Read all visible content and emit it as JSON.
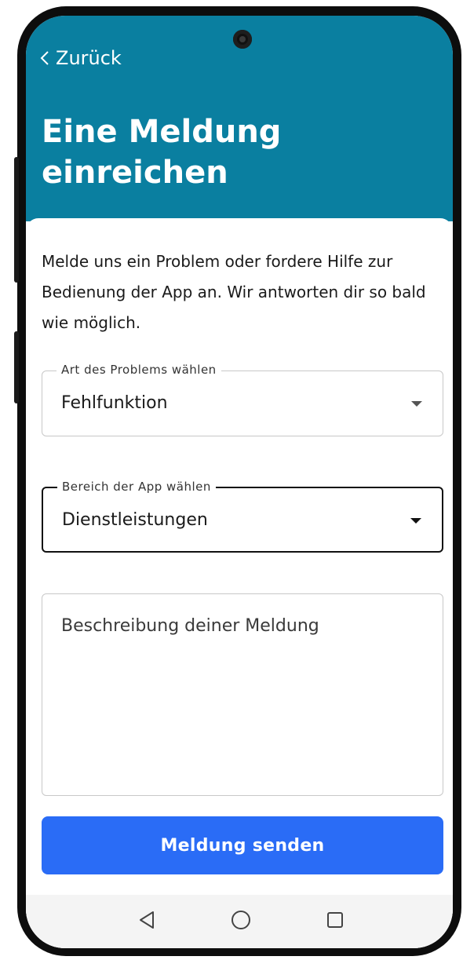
{
  "header": {
    "back_label": "Zurück",
    "title": "Eine Meldung einreichen",
    "background_color": "#0a7fa0"
  },
  "intro": {
    "text": "Melde uns ein Problem oder fordere Hilfe zur Bedienung der App an. Wir antworten dir so bald wie möglich."
  },
  "form": {
    "problem_type": {
      "label": "Art des Problems wählen",
      "value": "Fehlfunktion"
    },
    "app_area": {
      "label": "Bereich der App wählen",
      "value": "Dienstleistungen"
    },
    "description": {
      "placeholder": "Beschreibung deiner Meldung"
    },
    "submit_label": "Meldung senden",
    "submit_color": "#2a6cf6"
  },
  "navbar": {
    "icons": [
      "back-triangle-icon",
      "home-circle-icon",
      "recents-square-icon"
    ]
  }
}
